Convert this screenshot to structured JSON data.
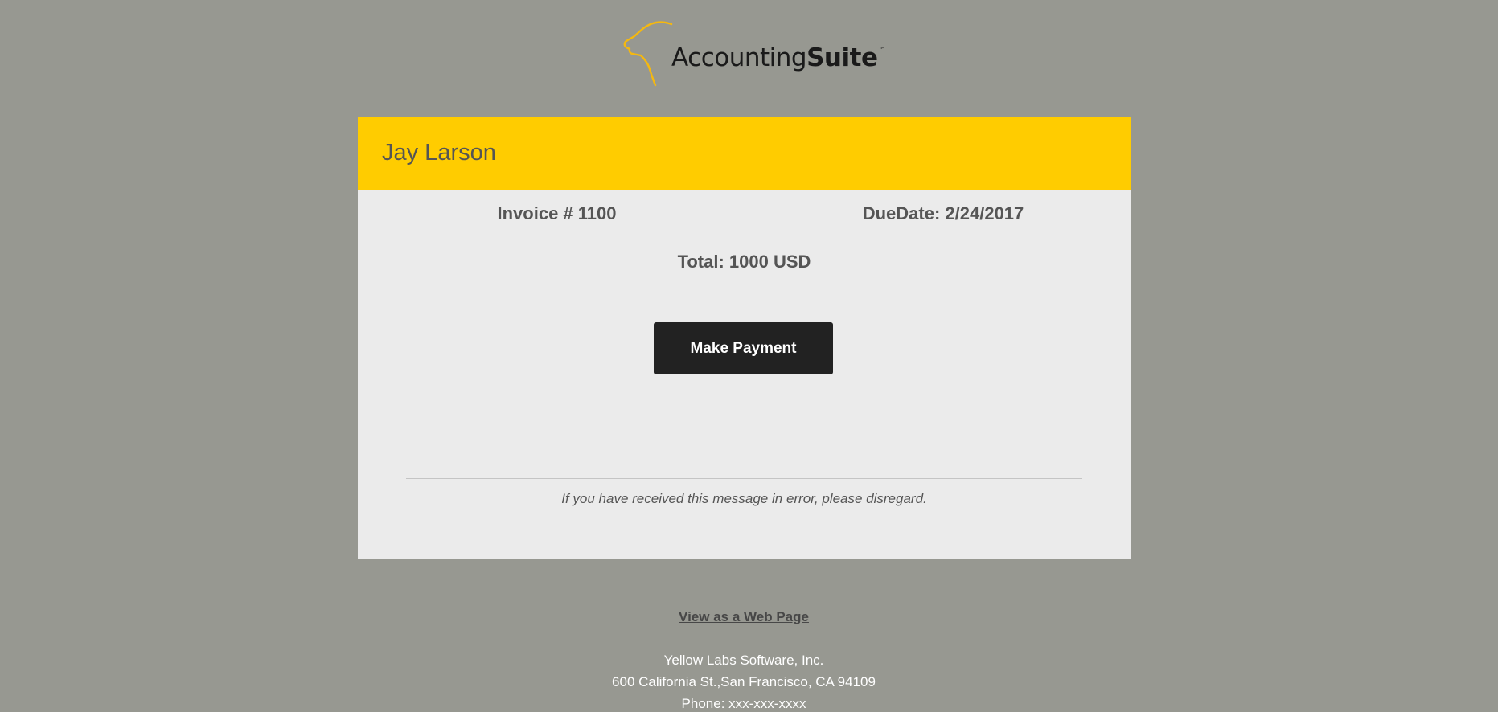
{
  "brand": {
    "name_light": "Accounting",
    "name_bold": "Suite",
    "trademark": "™",
    "accent_color": "#ffcc00"
  },
  "invoice": {
    "customer_name": "Jay Larson",
    "invoice_number": "Invoice # 1100",
    "due_date": "DueDate: 2/24/2017",
    "total": "Total: 1000 USD",
    "pay_button_label": "Make Payment",
    "disclaimer": "If you have received this message in error, please disregard."
  },
  "footer": {
    "web_link": "View as a Web Page",
    "company": "Yellow Labs Software, Inc.",
    "address": "600 California St.,San Francisco, CA 94109",
    "phone": "Phone: xxx-xxx-xxxx"
  }
}
